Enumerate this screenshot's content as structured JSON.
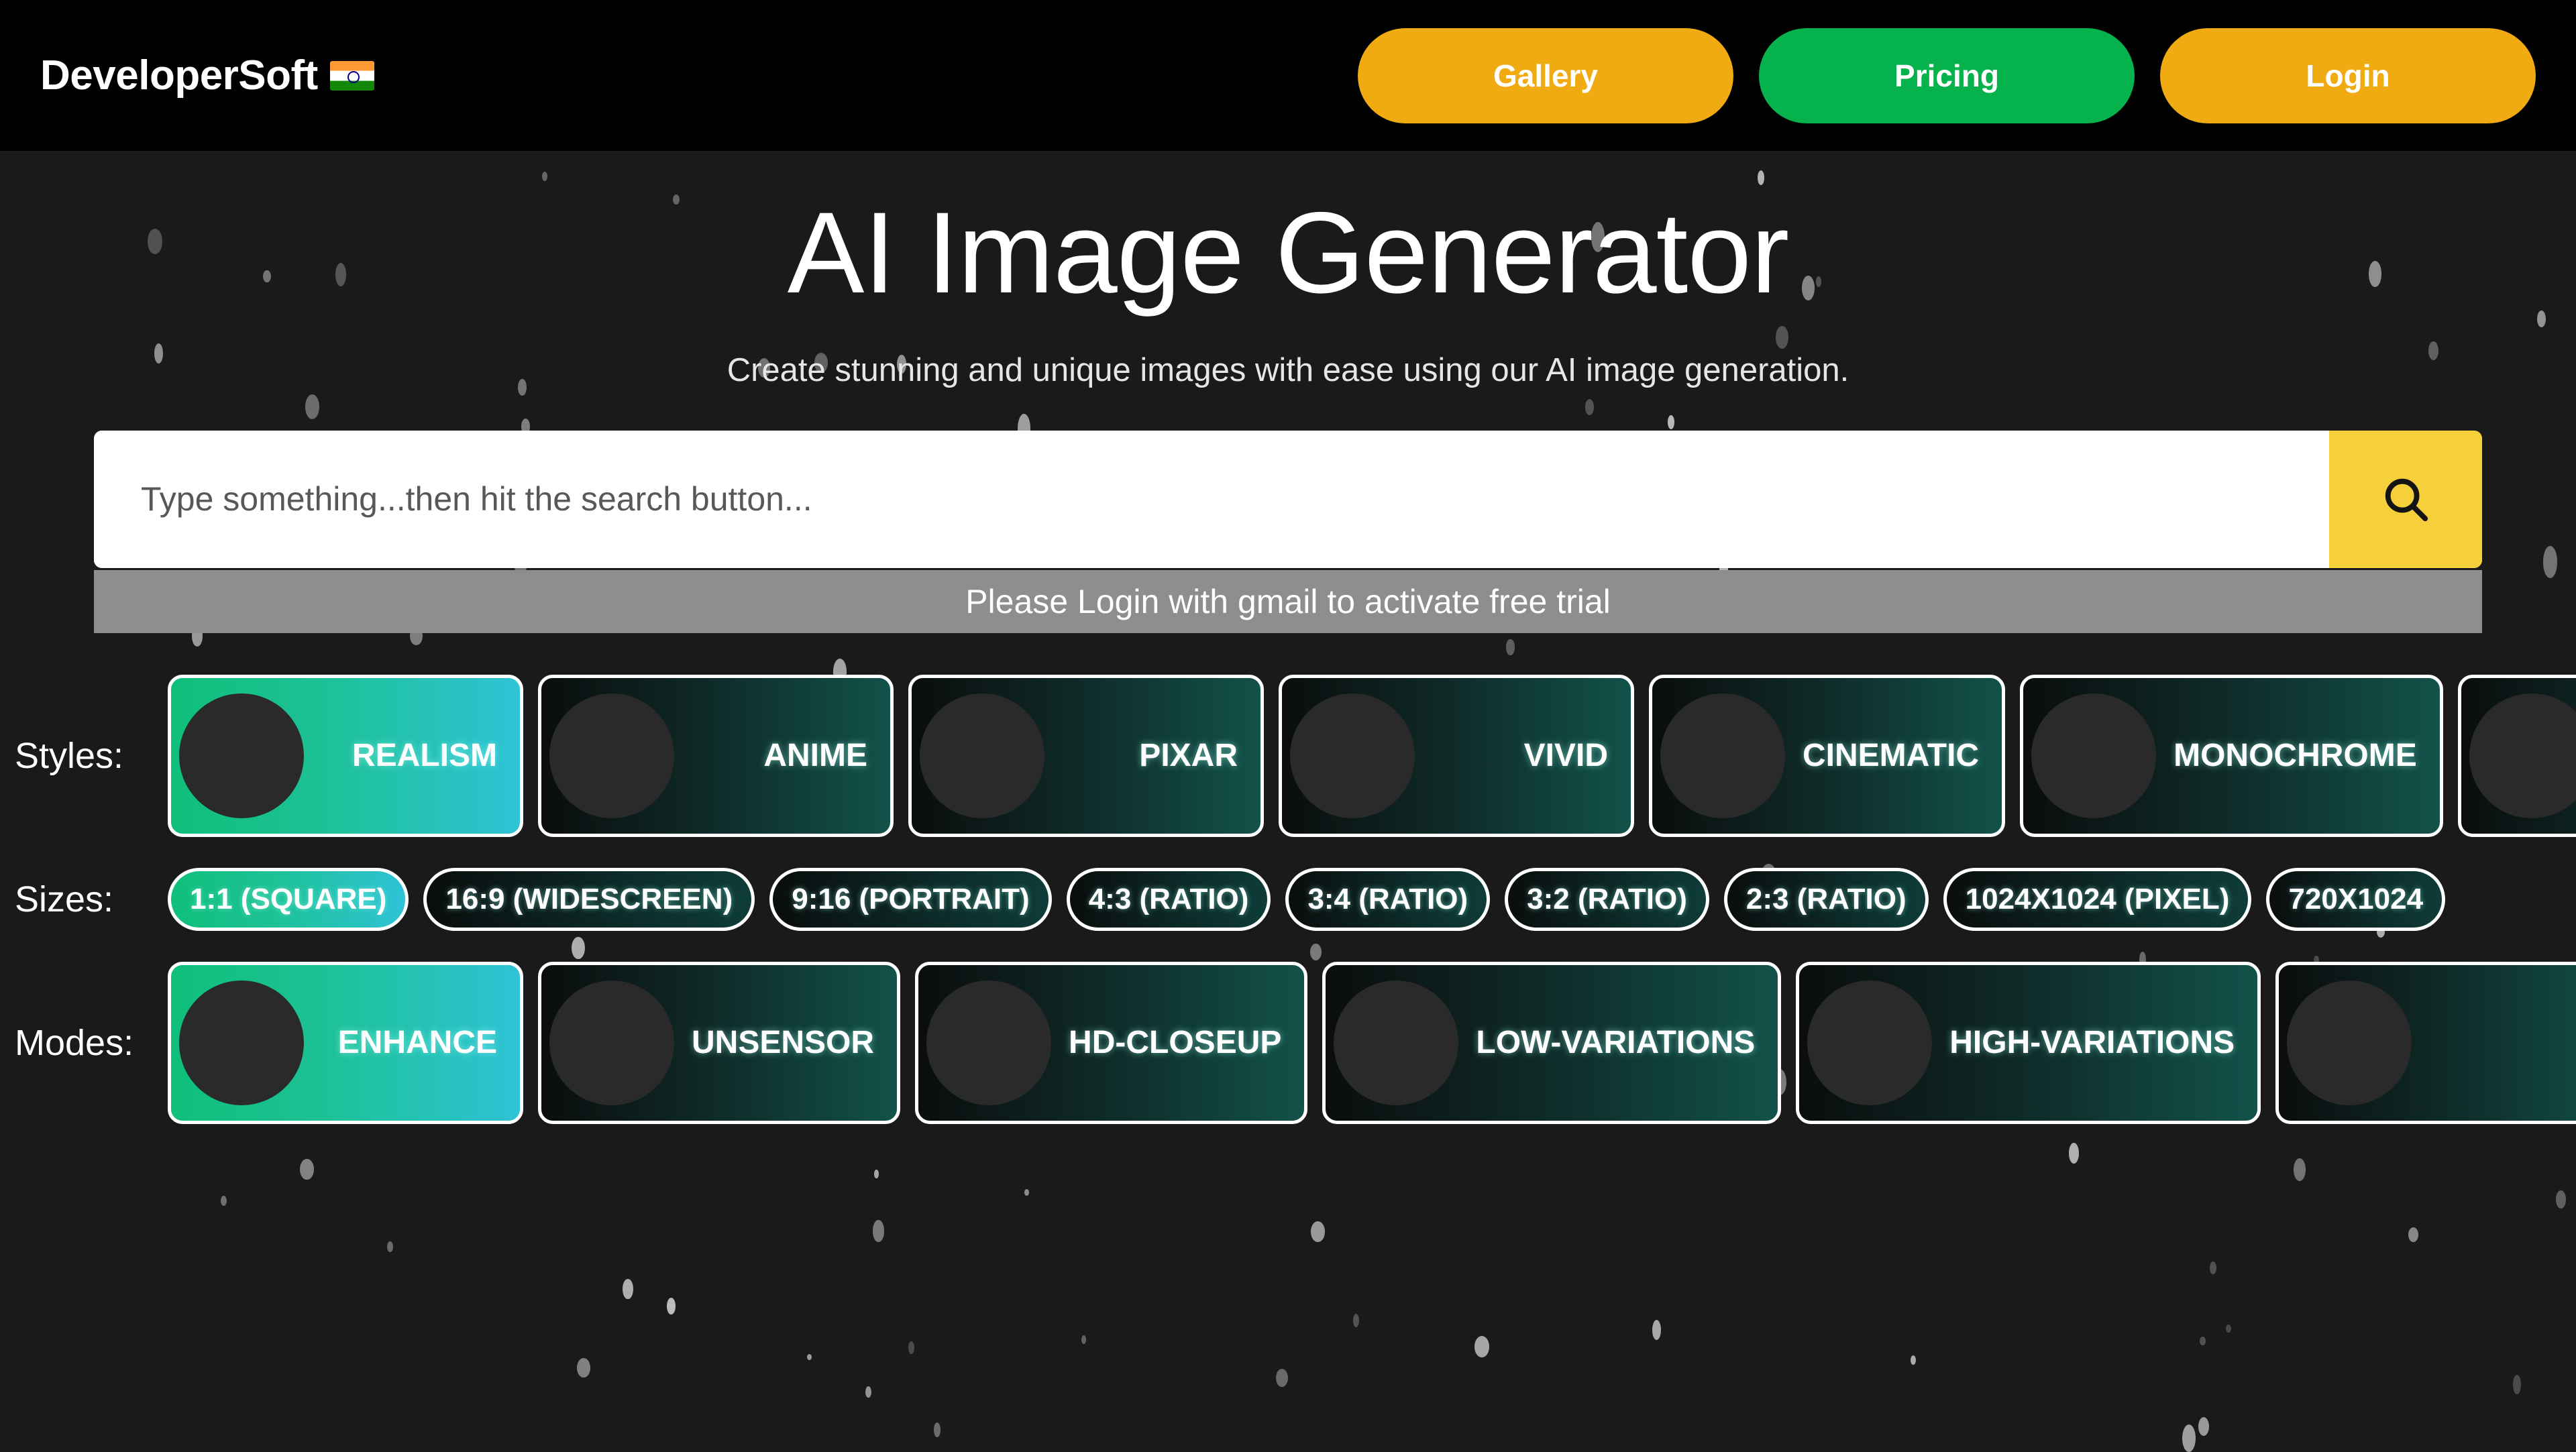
{
  "header": {
    "brand": "DeveloperSoft",
    "flag_icon": "india-flag-icon",
    "nav": [
      {
        "label": "Gallery",
        "color": "#f0ab12"
      },
      {
        "label": "Pricing",
        "color": "#06b24c"
      },
      {
        "label": "Login",
        "color": "#f0ab12"
      }
    ]
  },
  "hero": {
    "title": "AI Image Generator",
    "subtitle": "Create stunning and unique images with ease using our AI image generation."
  },
  "search": {
    "placeholder": "Type something...then hit the search button...",
    "value": "",
    "button_icon": "search-icon",
    "button_color": "#f5d03a",
    "notice": "Please Login with gmail to activate free trial",
    "notice_bg": "#8e8e8e"
  },
  "styles": {
    "label": "Styles:",
    "selected": "REALISM",
    "items": [
      {
        "label": "REALISM",
        "thumb": "th-realism",
        "selected": true
      },
      {
        "label": "ANIME",
        "thumb": "th-anime",
        "selected": false
      },
      {
        "label": "PIXAR",
        "thumb": "th-pixar",
        "selected": false
      },
      {
        "label": "VIVID",
        "thumb": "th-vivid",
        "selected": false
      },
      {
        "label": "CINEMATIC",
        "thumb": "th-cinematic",
        "selected": false
      },
      {
        "label": "MONOCHROME",
        "thumb": "th-monochrome",
        "selected": false
      },
      {
        "label": "",
        "thumb": "th-cubism",
        "selected": false
      }
    ]
  },
  "sizes": {
    "label": "Sizes:",
    "selected": "1:1 (SQUARE)",
    "items": [
      {
        "label": "1:1 (SQUARE)",
        "selected": true
      },
      {
        "label": "16:9 (WIDESCREEN)",
        "selected": false
      },
      {
        "label": "9:16 (PORTRAIT)",
        "selected": false
      },
      {
        "label": "4:3 (RATIO)",
        "selected": false
      },
      {
        "label": "3:4 (RATIO)",
        "selected": false
      },
      {
        "label": "3:2 (RATIO)",
        "selected": false
      },
      {
        "label": "2:3 (RATIO)",
        "selected": false
      },
      {
        "label": "1024X1024 (PIXEL)",
        "selected": false
      },
      {
        "label": "720X1024",
        "selected": false
      }
    ]
  },
  "modes": {
    "label": "Modes:",
    "selected": "ENHANCE",
    "items": [
      {
        "label": "ENHANCE",
        "thumb": "th-enhance",
        "selected": true
      },
      {
        "label": "UNSENSOR",
        "thumb": "th-unsensor",
        "selected": false
      },
      {
        "label": "HD-CLOSEUP",
        "thumb": "th-hdcloseup",
        "selected": false
      },
      {
        "label": "LOW-VARIATIONS",
        "thumb": "th-lowvar",
        "selected": false
      },
      {
        "label": "HIGH-VARIATIONS",
        "thumb": "th-highvar",
        "selected": false
      },
      {
        "label": "",
        "thumb": "th-extra-mode",
        "selected": false
      }
    ]
  },
  "theme": {
    "page_bg": "#1a1a1a",
    "header_bg": "#000000",
    "accent_amber": "#f0ab12",
    "accent_green": "#06b24c",
    "accent_yellow": "#f5d03a",
    "selected_gradient_start": "#0fbf7a",
    "selected_gradient_end": "#2ec3d6"
  }
}
